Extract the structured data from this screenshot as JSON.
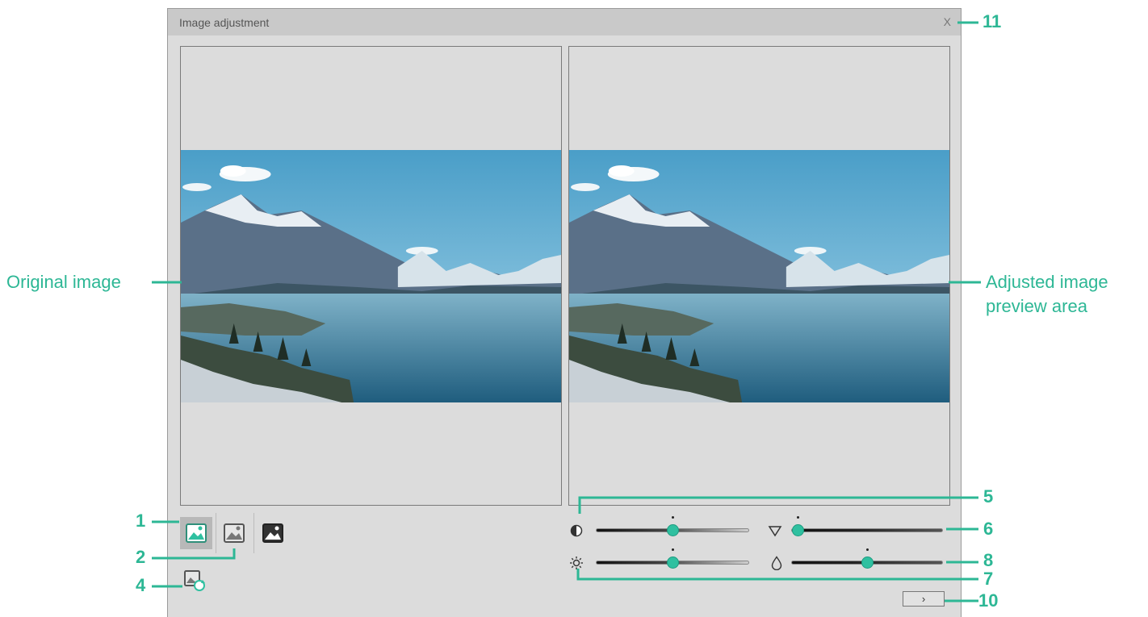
{
  "window": {
    "title": "Image adjustment",
    "close_label": "X"
  },
  "annotations": {
    "original_image": "Original image",
    "adjusted_preview_line1": "Adjusted image",
    "adjusted_preview_line2": "preview area",
    "markers": [
      "1",
      "2",
      "4",
      "5",
      "6",
      "7",
      "8",
      "10",
      "11"
    ]
  },
  "sliders": {
    "contrast": {
      "icon": "contrast-icon",
      "value_fraction": 0.5,
      "default_fraction": 0.5
    },
    "gamma": {
      "icon": "triangle-icon",
      "value_fraction": 0.0,
      "default_fraction": 0.0
    },
    "brightness": {
      "icon": "brightness-icon",
      "value_fraction": 0.5,
      "default_fraction": 0.5
    },
    "saturation": {
      "icon": "droplet-icon",
      "value_fraction": 0.5,
      "default_fraction": 0.5
    }
  },
  "next_button": {
    "label": "›"
  },
  "colors": {
    "accent": "#2db795",
    "thumb": "#2fc0a0",
    "window_bg": "#dcdcdc",
    "titlebar_bg": "#c9c9c9"
  }
}
